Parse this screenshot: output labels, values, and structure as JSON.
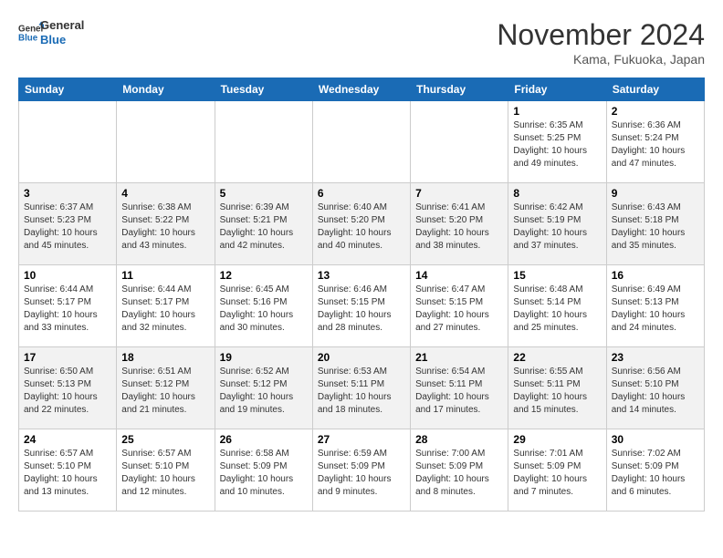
{
  "header": {
    "logo_line1": "General",
    "logo_line2": "Blue",
    "month": "November 2024",
    "location": "Kama, Fukuoka, Japan"
  },
  "weekdays": [
    "Sunday",
    "Monday",
    "Tuesday",
    "Wednesday",
    "Thursday",
    "Friday",
    "Saturday"
  ],
  "weeks": [
    [
      {
        "day": "",
        "info": ""
      },
      {
        "day": "",
        "info": ""
      },
      {
        "day": "",
        "info": ""
      },
      {
        "day": "",
        "info": ""
      },
      {
        "day": "",
        "info": ""
      },
      {
        "day": "1",
        "info": "Sunrise: 6:35 AM\nSunset: 5:25 PM\nDaylight: 10 hours\nand 49 minutes."
      },
      {
        "day": "2",
        "info": "Sunrise: 6:36 AM\nSunset: 5:24 PM\nDaylight: 10 hours\nand 47 minutes."
      }
    ],
    [
      {
        "day": "3",
        "info": "Sunrise: 6:37 AM\nSunset: 5:23 PM\nDaylight: 10 hours\nand 45 minutes."
      },
      {
        "day": "4",
        "info": "Sunrise: 6:38 AM\nSunset: 5:22 PM\nDaylight: 10 hours\nand 43 minutes."
      },
      {
        "day": "5",
        "info": "Sunrise: 6:39 AM\nSunset: 5:21 PM\nDaylight: 10 hours\nand 42 minutes."
      },
      {
        "day": "6",
        "info": "Sunrise: 6:40 AM\nSunset: 5:20 PM\nDaylight: 10 hours\nand 40 minutes."
      },
      {
        "day": "7",
        "info": "Sunrise: 6:41 AM\nSunset: 5:20 PM\nDaylight: 10 hours\nand 38 minutes."
      },
      {
        "day": "8",
        "info": "Sunrise: 6:42 AM\nSunset: 5:19 PM\nDaylight: 10 hours\nand 37 minutes."
      },
      {
        "day": "9",
        "info": "Sunrise: 6:43 AM\nSunset: 5:18 PM\nDaylight: 10 hours\nand 35 minutes."
      }
    ],
    [
      {
        "day": "10",
        "info": "Sunrise: 6:44 AM\nSunset: 5:17 PM\nDaylight: 10 hours\nand 33 minutes."
      },
      {
        "day": "11",
        "info": "Sunrise: 6:44 AM\nSunset: 5:17 PM\nDaylight: 10 hours\nand 32 minutes."
      },
      {
        "day": "12",
        "info": "Sunrise: 6:45 AM\nSunset: 5:16 PM\nDaylight: 10 hours\nand 30 minutes."
      },
      {
        "day": "13",
        "info": "Sunrise: 6:46 AM\nSunset: 5:15 PM\nDaylight: 10 hours\nand 28 minutes."
      },
      {
        "day": "14",
        "info": "Sunrise: 6:47 AM\nSunset: 5:15 PM\nDaylight: 10 hours\nand 27 minutes."
      },
      {
        "day": "15",
        "info": "Sunrise: 6:48 AM\nSunset: 5:14 PM\nDaylight: 10 hours\nand 25 minutes."
      },
      {
        "day": "16",
        "info": "Sunrise: 6:49 AM\nSunset: 5:13 PM\nDaylight: 10 hours\nand 24 minutes."
      }
    ],
    [
      {
        "day": "17",
        "info": "Sunrise: 6:50 AM\nSunset: 5:13 PM\nDaylight: 10 hours\nand 22 minutes."
      },
      {
        "day": "18",
        "info": "Sunrise: 6:51 AM\nSunset: 5:12 PM\nDaylight: 10 hours\nand 21 minutes."
      },
      {
        "day": "19",
        "info": "Sunrise: 6:52 AM\nSunset: 5:12 PM\nDaylight: 10 hours\nand 19 minutes."
      },
      {
        "day": "20",
        "info": "Sunrise: 6:53 AM\nSunset: 5:11 PM\nDaylight: 10 hours\nand 18 minutes."
      },
      {
        "day": "21",
        "info": "Sunrise: 6:54 AM\nSunset: 5:11 PM\nDaylight: 10 hours\nand 17 minutes."
      },
      {
        "day": "22",
        "info": "Sunrise: 6:55 AM\nSunset: 5:11 PM\nDaylight: 10 hours\nand 15 minutes."
      },
      {
        "day": "23",
        "info": "Sunrise: 6:56 AM\nSunset: 5:10 PM\nDaylight: 10 hours\nand 14 minutes."
      }
    ],
    [
      {
        "day": "24",
        "info": "Sunrise: 6:57 AM\nSunset: 5:10 PM\nDaylight: 10 hours\nand 13 minutes."
      },
      {
        "day": "25",
        "info": "Sunrise: 6:57 AM\nSunset: 5:10 PM\nDaylight: 10 hours\nand 12 minutes."
      },
      {
        "day": "26",
        "info": "Sunrise: 6:58 AM\nSunset: 5:09 PM\nDaylight: 10 hours\nand 10 minutes."
      },
      {
        "day": "27",
        "info": "Sunrise: 6:59 AM\nSunset: 5:09 PM\nDaylight: 10 hours\nand 9 minutes."
      },
      {
        "day": "28",
        "info": "Sunrise: 7:00 AM\nSunset: 5:09 PM\nDaylight: 10 hours\nand 8 minutes."
      },
      {
        "day": "29",
        "info": "Sunrise: 7:01 AM\nSunset: 5:09 PM\nDaylight: 10 hours\nand 7 minutes."
      },
      {
        "day": "30",
        "info": "Sunrise: 7:02 AM\nSunset: 5:09 PM\nDaylight: 10 hours\nand 6 minutes."
      }
    ]
  ]
}
